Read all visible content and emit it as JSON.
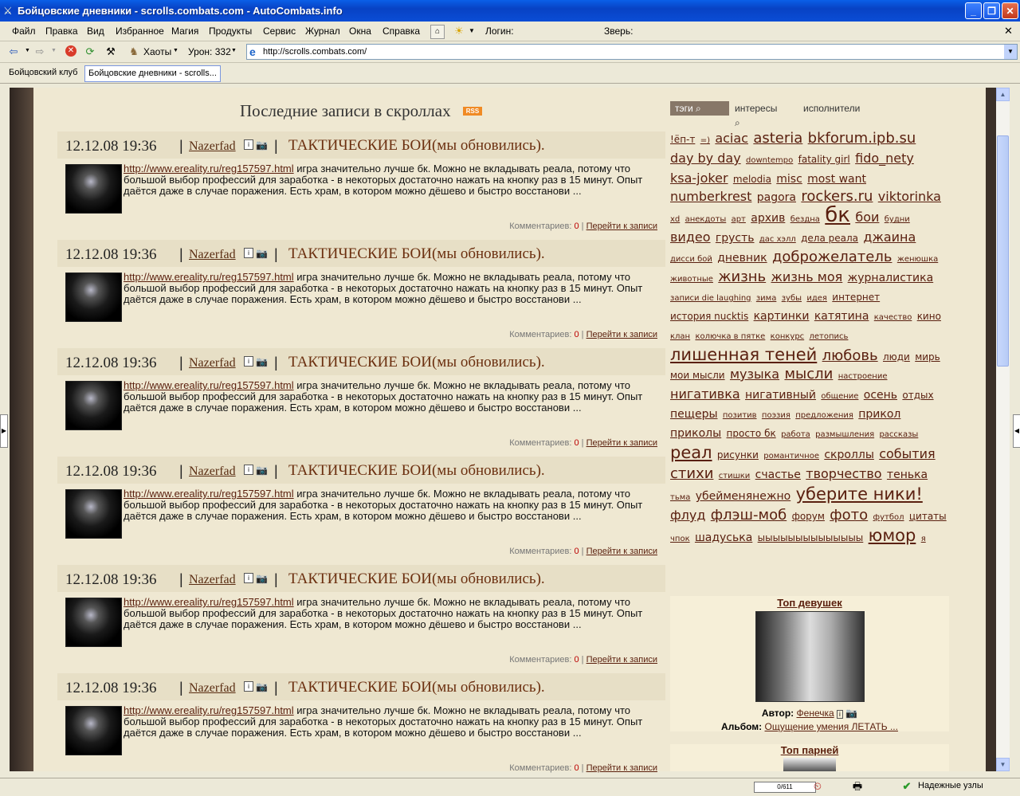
{
  "window": {
    "title": "Бойцовские дневники - scrolls.combats.com - AutoCombats.info",
    "min": "_",
    "max": "❐",
    "close": "✕"
  },
  "menu": [
    "Файл",
    "Правка",
    "Вид",
    "Избранное",
    "Магия",
    "Продукты",
    "Сервис",
    "Журнал",
    "Окна",
    "Справка"
  ],
  "toolbar": {
    "login_label": "Логин:",
    "beast_label": "Зверь:",
    "chaos_label": "Хаоты",
    "damage_label": "Урон: 332",
    "close_x": "✕"
  },
  "address": {
    "url": "http://scrolls.combats.com/"
  },
  "tabs": [
    "Бойцовский клуб",
    "Бойцовские дневники - scrolls..."
  ],
  "content": {
    "title": "Последние записи в скроллах",
    "rss": "RSS"
  },
  "posts": [
    {
      "date": "12.12.08 19:36",
      "author": "Nazerfad",
      "title": "ТАКТИЧЕСКИЕ БОИ(мы обновились).",
      "link": "http://www.ereality.ru/reg157597.html",
      "text": " игра значительно лучше бк. Можно не вкладывать реала, потому что большой выбор профессий для заработка - в некоторых достаточно нажать на кнопку раз в 15 минут. Опыт даётся даже в случае поражения. Есть храм, в котором можно дёшево и быстро восстанови ...",
      "comments_label": "Комментариев:",
      "comments": "0",
      "goto": "Перейти к записи"
    },
    {
      "date": "12.12.08 19:36",
      "author": "Nazerfad",
      "title": "ТАКТИЧЕСКИЕ БОИ(мы обновились).",
      "link": "http://www.ereality.ru/reg157597.html",
      "text": " игра значительно лучше бк. Можно не вкладывать реала, потому что большой выбор профессий для заработка - в некоторых достаточно нажать на кнопку раз в 15 минут. Опыт даётся даже в случае поражения. Есть храм, в котором можно дёшево и быстро восстанови ...",
      "comments_label": "Комментариев:",
      "comments": "0",
      "goto": "Перейти к записи"
    },
    {
      "date": "12.12.08 19:36",
      "author": "Nazerfad",
      "title": "ТАКТИЧЕСКИЕ БОИ(мы обновились).",
      "link": "http://www.ereality.ru/reg157597.html",
      "text": " игра значительно лучше бк. Можно не вкладывать реала, потому что большой выбор профессий для заработка - в некоторых достаточно нажать на кнопку раз в 15 минут. Опыт даётся даже в случае поражения. Есть храм, в котором можно дёшево и быстро восстанови ...",
      "comments_label": "Комментариев:",
      "comments": "0",
      "goto": "Перейти к записи"
    },
    {
      "date": "12.12.08 19:36",
      "author": "Nazerfad",
      "title": "ТАКТИЧЕСКИЕ БОИ(мы обновились).",
      "link": "http://www.ereality.ru/reg157597.html",
      "text": " игра значительно лучше бк. Можно не вкладывать реала, потому что большой выбор профессий для заработка - в некоторых достаточно нажать на кнопку раз в 15 минут. Опыт даётся даже в случае поражения. Есть храм, в котором можно дёшево и быстро восстанови ...",
      "comments_label": "Комментариев:",
      "comments": "0",
      "goto": "Перейти к записи"
    },
    {
      "date": "12.12.08 19:36",
      "author": "Nazerfad",
      "title": "ТАКТИЧЕСКИЕ БОИ(мы обновились).",
      "link": "http://www.ereality.ru/reg157597.html",
      "text": " игра значительно лучше бк. Можно не вкладывать реала, потому что большой выбор профессий для заработка - в некоторых достаточно нажать на кнопку раз в 15 минут. Опыт даётся даже в случае поражения. Есть храм, в котором можно дёшево и быстро восстанови ...",
      "comments_label": "Комментариев:",
      "comments": "0",
      "goto": "Перейти к записи"
    },
    {
      "date": "12.12.08 19:36",
      "author": "Nazerfad",
      "title": "ТАКТИЧЕСКИЕ БОИ(мы обновились).",
      "link": "http://www.ereality.ru/reg157597.html",
      "text": " игра значительно лучше бк. Можно не вкладывать реала, потому что большой выбор профессий для заработка - в некоторых достаточно нажать на кнопку раз в 15 минут. Опыт даётся даже в случае поражения. Есть храм, в котором можно дёшево и быстро восстанови ...",
      "comments_label": "Комментариев:",
      "comments": "0",
      "goto": "Перейти к записи"
    }
  ],
  "tag_tabs": [
    "тэги",
    "интересы",
    "исполнители"
  ],
  "tags": [
    [
      "!ёп-т",
      1
    ],
    [
      "=)",
      0
    ],
    [
      "aciac",
      3
    ],
    [
      "asteria",
      4
    ],
    [
      "bkforum.ipb.su",
      4
    ],
    [
      "day by day",
      3
    ],
    [
      "downtempo",
      0
    ],
    [
      "fatality girl",
      1
    ],
    [
      "fido_nety",
      3
    ],
    [
      "ksa-joker",
      3
    ],
    [
      "melodia",
      1
    ],
    [
      "misc",
      2
    ],
    [
      "most want",
      2
    ],
    [
      "numberkrest",
      3
    ],
    [
      "pagora",
      2
    ],
    [
      "rockers.ru",
      4
    ],
    [
      "viktorinka",
      3
    ],
    [
      "xd",
      0
    ],
    [
      "анекдоты",
      0
    ],
    [
      "арт",
      0
    ],
    [
      "архив",
      2
    ],
    [
      "безднa",
      0
    ],
    [
      "бк",
      6
    ],
    [
      "бои",
      3
    ],
    [
      "будни",
      0
    ],
    [
      "видео",
      3
    ],
    [
      "грусть",
      2
    ],
    [
      "дас хэлл",
      0
    ],
    [
      "дела реала",
      1
    ],
    [
      "джаина",
      3
    ],
    [
      "дисси бой",
      0
    ],
    [
      "дневник",
      2
    ],
    [
      "доброжелатель",
      4
    ],
    [
      "женюшка",
      0
    ],
    [
      "животные",
      0
    ],
    [
      "жизнь",
      4
    ],
    [
      "жизнь моя",
      3
    ],
    [
      "журналистика",
      2
    ],
    [
      "записи die laughing",
      0
    ],
    [
      "зима",
      0
    ],
    [
      "зубы",
      0
    ],
    [
      "идея",
      0
    ],
    [
      "интернет",
      1
    ],
    [
      "история nucktis",
      1
    ],
    [
      "картинки",
      2
    ],
    [
      "катятина",
      2
    ],
    [
      "качество",
      0
    ],
    [
      "кино",
      1
    ],
    [
      "клан",
      0
    ],
    [
      "колючка в пятке",
      0
    ],
    [
      "конкурс",
      0
    ],
    [
      "летопись",
      0
    ],
    [
      "лишенная теней",
      5
    ],
    [
      "любовь",
      4
    ],
    [
      "люди",
      1
    ],
    [
      "мирь",
      1
    ],
    [
      "мои мысли",
      1
    ],
    [
      "музыка",
      3
    ],
    [
      "мысли",
      4
    ],
    [
      "настроение",
      0
    ],
    [
      "нигативка",
      3
    ],
    [
      "нигативный",
      2
    ],
    [
      "общение",
      0
    ],
    [
      "осень",
      2
    ],
    [
      "отдых",
      1
    ],
    [
      "пещеры",
      2
    ],
    [
      "позитив",
      0
    ],
    [
      "поэзия",
      0
    ],
    [
      "предложения",
      0
    ],
    [
      "прикол",
      2
    ],
    [
      "приколы",
      2
    ],
    [
      "просто бк",
      1
    ],
    [
      "работа",
      0
    ],
    [
      "размышления",
      0
    ],
    [
      "рассказы",
      0
    ],
    [
      "реал",
      5
    ],
    [
      "рисунки",
      1
    ],
    [
      "романтичное",
      0
    ],
    [
      "скроллы",
      2
    ],
    [
      "события",
      3
    ],
    [
      "стихи",
      4
    ],
    [
      "стишки",
      0
    ],
    [
      "счастье",
      2
    ],
    [
      "творчество",
      3
    ],
    [
      "тенька",
      2
    ],
    [
      "тьма",
      0
    ],
    [
      "убейменянежно",
      2
    ],
    [
      "уберите ники!",
      5
    ],
    [
      "флуд",
      3
    ],
    [
      "флэш-моб",
      4
    ],
    [
      "форум",
      1
    ],
    [
      "фото",
      4
    ],
    [
      "футбол",
      0
    ],
    [
      "цитаты",
      1
    ],
    [
      "чпок",
      0
    ],
    [
      "шадуська",
      2
    ],
    [
      "ыыыыыыыыыыыыыы",
      1
    ],
    [
      "юмор",
      5
    ],
    [
      "я",
      0
    ]
  ],
  "top_girls": {
    "title": "Топ девушек",
    "author_label": "Автор:",
    "author": "Фенечка",
    "album_label": "Альбом:",
    "album": "Ощущение умения ЛЕТАТЬ ..."
  },
  "top_boys": {
    "title": "Топ парней"
  },
  "status": {
    "progress": "0/611",
    "trusted": "Надежные узлы"
  }
}
